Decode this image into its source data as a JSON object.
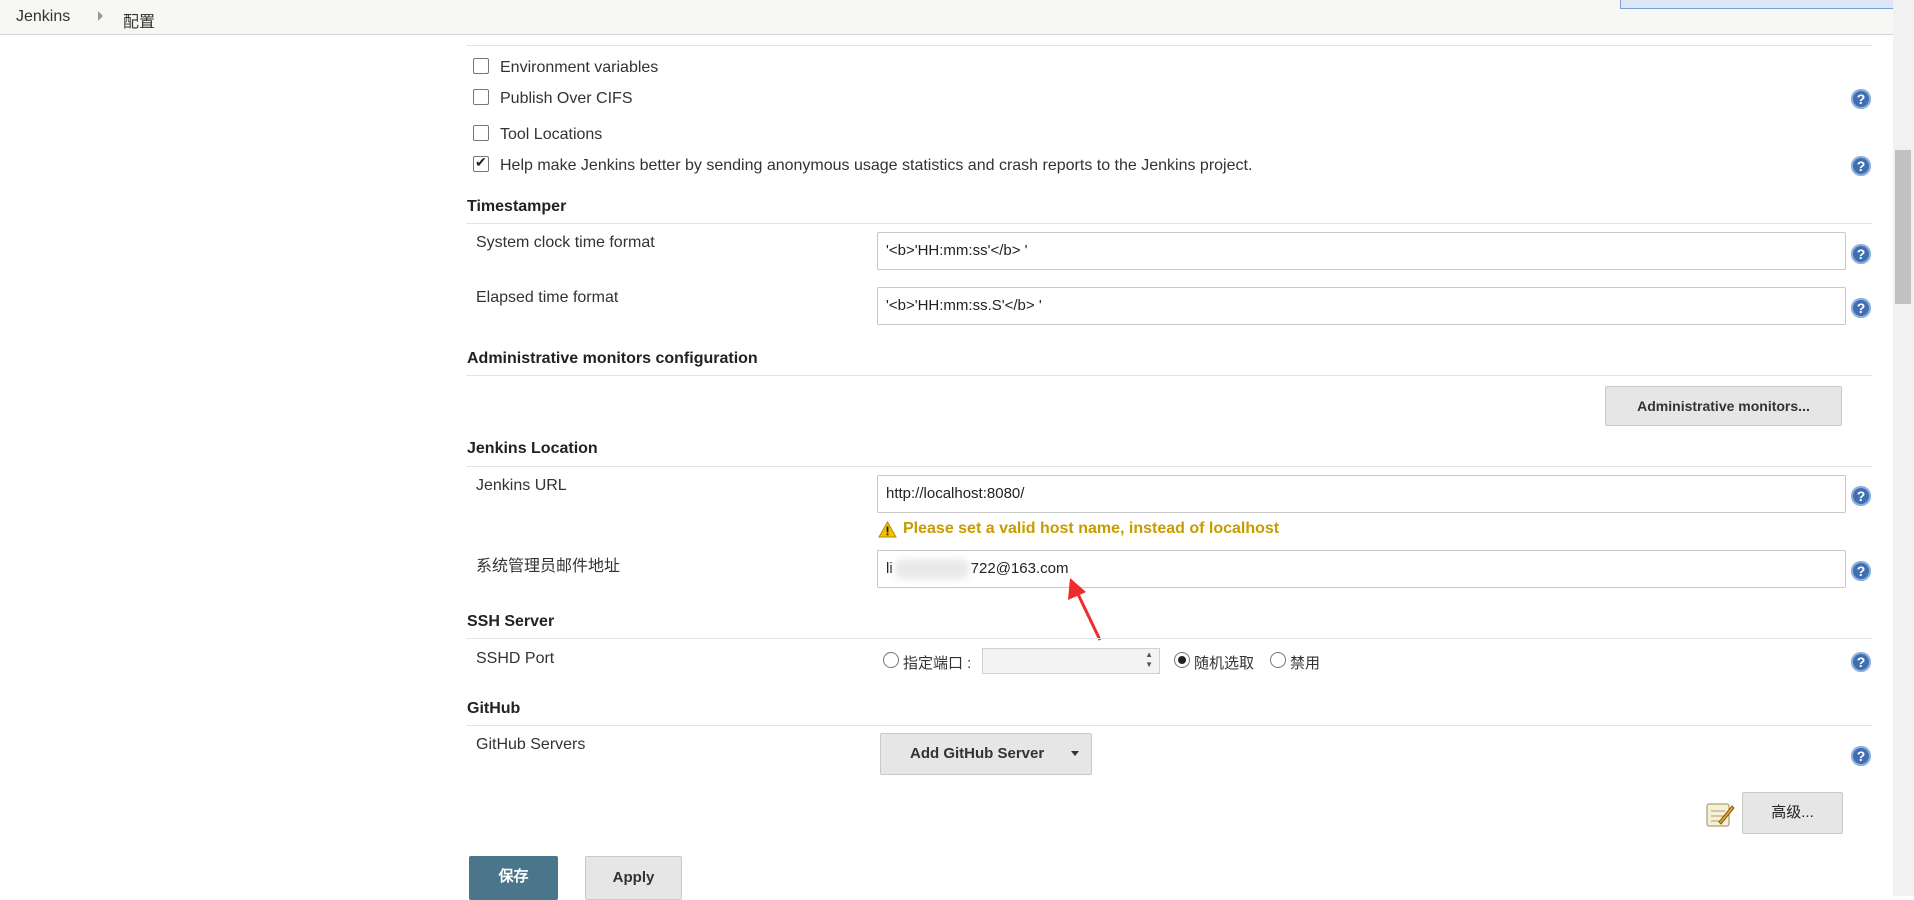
{
  "breadcrumb": {
    "root": "Jenkins",
    "current": "配置"
  },
  "global_properties": {
    "items": [
      {
        "label": "Environment variables",
        "checked": false
      },
      {
        "label": "Publish Over CIFS",
        "checked": false
      },
      {
        "label": "Tool Locations",
        "checked": false
      },
      {
        "label": "Help make Jenkins better by sending anonymous usage statistics and crash reports to the Jenkins project.",
        "checked": true
      }
    ]
  },
  "timestamper": {
    "title": "Timestamper",
    "system_clock_label": "System clock time format",
    "system_clock_value": "'<b>'HH:mm:ss'</b> '",
    "elapsed_label": "Elapsed time format",
    "elapsed_value": "'<b>'HH:mm:ss.S'</b> '"
  },
  "admin_monitors": {
    "title": "Administrative monitors configuration",
    "button": "Administrative monitors..."
  },
  "jenkins_location": {
    "title": "Jenkins Location",
    "url_label": "Jenkins URL",
    "url_value": "http://localhost:8080/",
    "warning": "Please set a valid host name, instead of localhost",
    "email_label": "系统管理员邮件地址",
    "email_prefix": "li",
    "email_suffix": "722@163.com"
  },
  "ssh_server": {
    "title": "SSH Server",
    "port_label": "SSHD Port",
    "option_fixed": "指定端口 :",
    "option_random": "随机选取",
    "option_disabled": "禁用",
    "selected": "random"
  },
  "github": {
    "title": "GitHub",
    "servers_label": "GitHub Servers",
    "add_button": "Add GitHub Server"
  },
  "advanced_button": "高级...",
  "footer": {
    "save": "保存",
    "apply": "Apply"
  },
  "help_glyph": "?",
  "colors": {
    "save_button": "#4b758b",
    "warning": "#c89b00",
    "help_icon": "#3f6fb0",
    "annotation_arrow": "#ee2a2a"
  }
}
